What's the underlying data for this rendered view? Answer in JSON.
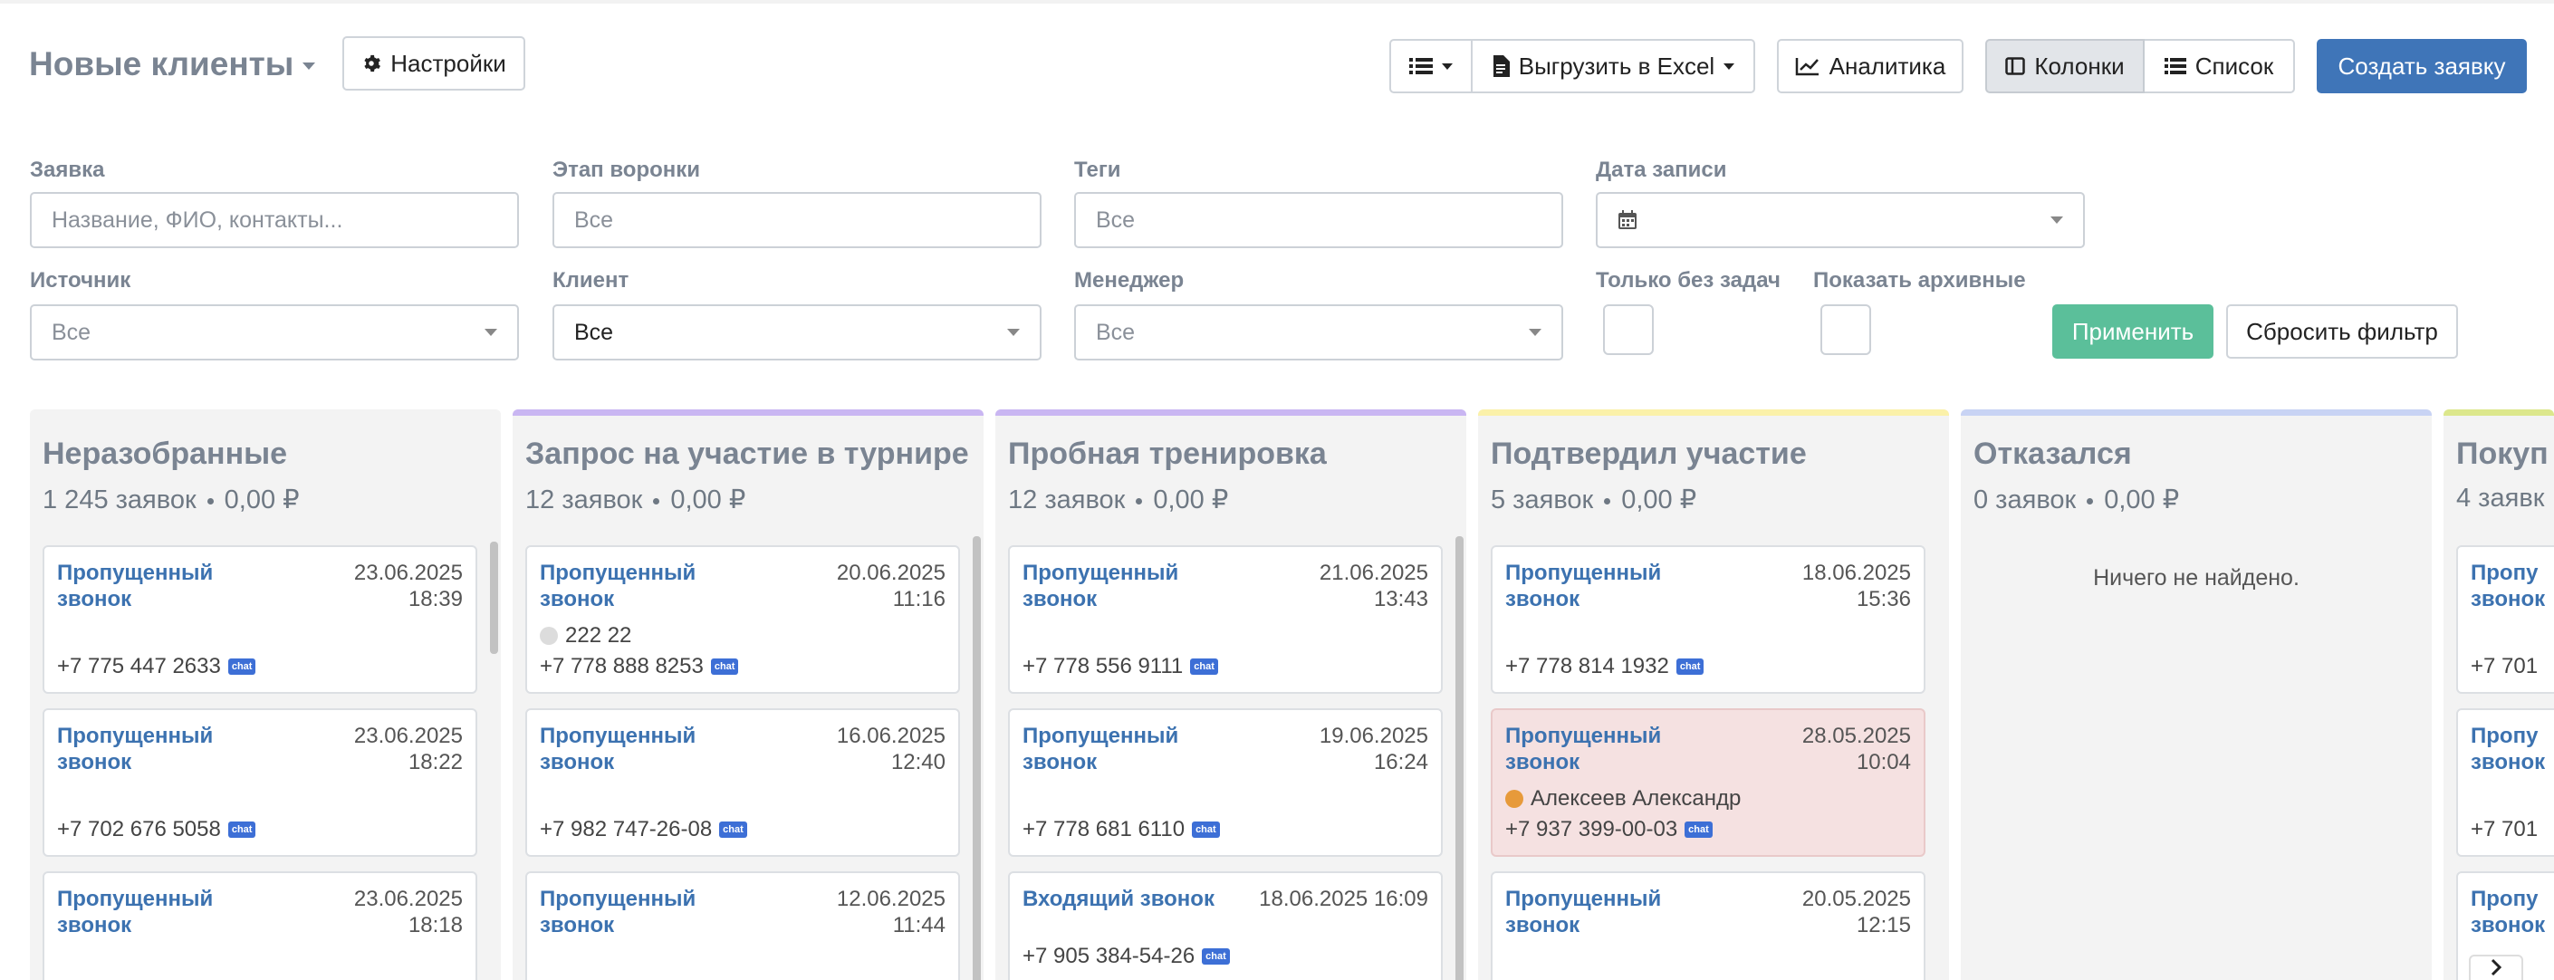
{
  "header": {
    "title": "Новые клиенты",
    "settings_label": "Настройки",
    "export_label": "Выгрузить в Excel",
    "analytics_label": "Аналитика",
    "view_columns_label": "Колонки",
    "view_list_label": "Список",
    "create_label": "Создать заявку"
  },
  "filters": {
    "request": {
      "label": "Заявка",
      "placeholder": "Название, ФИО, контакты..."
    },
    "stage": {
      "label": "Этап воронки",
      "placeholder": "Все"
    },
    "tags": {
      "label": "Теги",
      "placeholder": "Все"
    },
    "date": {
      "label": "Дата записи",
      "value": ""
    },
    "source": {
      "label": "Источник",
      "value": "Все"
    },
    "client": {
      "label": "Клиент",
      "value": "Все"
    },
    "manager": {
      "label": "Менеджер",
      "value": "Все"
    },
    "no_tasks": {
      "label": "Только без задач",
      "checked": false
    },
    "archived": {
      "label": "Показать архивные",
      "checked": false
    },
    "apply_label": "Применить",
    "reset_label": "Сбросить фильтр"
  },
  "columns": [
    {
      "title": "Неразобранные",
      "count": "1 245 заявок",
      "sum": "0,00 ₽",
      "color": "#f3f3f3",
      "cards": [
        {
          "title": "Пропущенный звонок",
          "date": "23.06.2025",
          "time": "18:39",
          "phone": "+7 775 447 2633"
        },
        {
          "title": "Пропущенный звонок",
          "date": "23.06.2025",
          "time": "18:22",
          "phone": "+7 702 676 5058"
        },
        {
          "title": "Пропущенный звонок",
          "date": "23.06.2025",
          "time": "18:18",
          "phone": ""
        }
      ]
    },
    {
      "title": "Запрос на участие в турнире",
      "count": "12 заявок",
      "sum": "0,00 ₽",
      "color": "#c9b6f2",
      "cards": [
        {
          "title": "Пропущенный звонок",
          "date": "20.06.2025",
          "time": "11:16",
          "person": "222 22",
          "phone": "+7 778 888 8253"
        },
        {
          "title": "Пропущенный звонок",
          "date": "16.06.2025",
          "time": "12:40",
          "phone": "+7 982 747-26-08"
        },
        {
          "title": "Пропущенный звонок",
          "date": "12.06.2025",
          "time": "11:44",
          "phone": ""
        }
      ]
    },
    {
      "title": "Пробная тренировка",
      "count": "12 заявок",
      "sum": "0,00 ₽",
      "color": "#c9b6f2",
      "cards": [
        {
          "title": "Пропущенный звонок",
          "date": "21.06.2025",
          "time": "13:43",
          "phone": "+7 778 556 9111"
        },
        {
          "title": "Пропущенный звонок",
          "date": "19.06.2025",
          "time": "16:24",
          "phone": "+7 778 681 6110"
        },
        {
          "title": "Входящий звонок",
          "date": "18.06.2025 16:09",
          "phone": "+7 905 384-54-26"
        }
      ]
    },
    {
      "title": "Подтвердил участие",
      "count": "5 заявок",
      "sum": "0,00 ₽",
      "color": "#fbf1a9",
      "cards": [
        {
          "title": "Пропущенный звонок",
          "date": "18.06.2025",
          "time": "15:36",
          "phone": "+7 778 814 1932"
        },
        {
          "title": "Пропущенный звонок",
          "date": "28.05.2025",
          "time": "10:04",
          "person": "Алексеев Александр",
          "phone": "+7 937 399-00-03"
        },
        {
          "title": "Пропущенный звонок",
          "date": "20.05.2025",
          "time": "12:15",
          "phone": ""
        }
      ]
    },
    {
      "title": "Отказался",
      "count": "0 заявок",
      "sum": "0,00 ₽",
      "color": "#c8d3f4",
      "empty": "Ничего не найдено."
    },
    {
      "title": "Покуп",
      "count": "4 заявк",
      "color": "#dce78c",
      "cards": [
        {
          "title": "Пропу",
          "title2": "звонок",
          "phone": "+7 701"
        },
        {
          "title": "Пропу",
          "title2": "звонок",
          "phone": "+7 701"
        },
        {
          "title": "Пропу",
          "title2": "звонок"
        }
      ]
    }
  ],
  "chat_badge": "chat",
  "icons": [
    "gear-icon",
    "list-icon",
    "excel-icon",
    "chart-icon",
    "columns-icon",
    "list-view-icon",
    "calendar-icon",
    "chevron-right-icon"
  ]
}
